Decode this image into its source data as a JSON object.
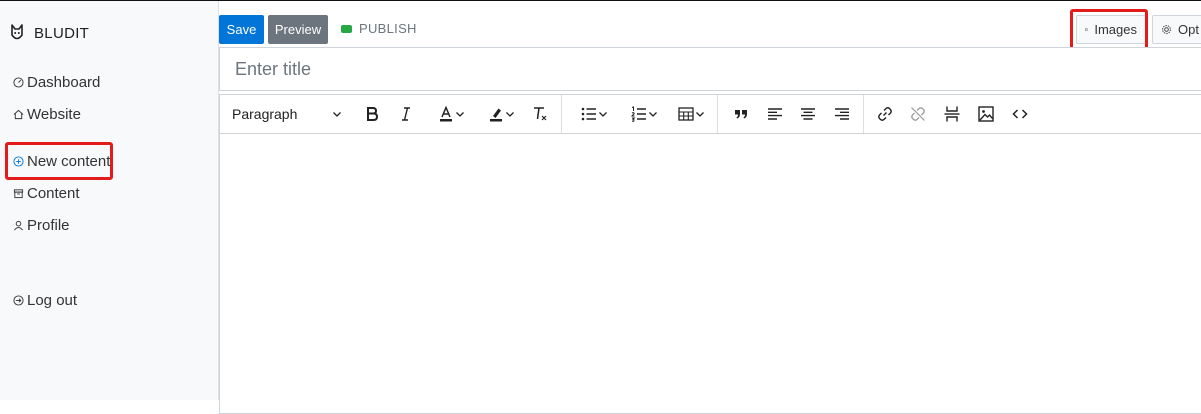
{
  "brand": {
    "name": "BLUDIT",
    "logo_icon": "bludit-logo-icon"
  },
  "sidebar": {
    "items": [
      {
        "label": "Dashboard",
        "icon": "speedometer-icon"
      },
      {
        "label": "Website",
        "icon": "home-icon"
      },
      {
        "label": "New content",
        "icon": "plus-circle-icon",
        "highlighted": true
      },
      {
        "label": "Content",
        "icon": "archive-icon"
      },
      {
        "label": "Profile",
        "icon": "user-icon"
      },
      {
        "label": "Log out",
        "icon": "logout-icon"
      }
    ]
  },
  "toolbar": {
    "save_label": "Save",
    "preview_label": "Preview",
    "status_label": "PUBLISH",
    "images_label": "Images",
    "options_label": "Opt"
  },
  "title": {
    "placeholder": "Enter title",
    "value": ""
  },
  "editor": {
    "format_select": "Paragraph",
    "tools": [
      "bold-icon",
      "italic-icon",
      "text-color-icon",
      "highlight-icon",
      "clear-format-icon",
      "bullet-list-icon",
      "numbered-list-icon",
      "table-icon",
      "blockquote-icon",
      "align-left-icon",
      "align-center-icon",
      "align-right-icon",
      "link-icon",
      "unlink-icon",
      "page-break-icon",
      "image-icon",
      "code-icon"
    ]
  },
  "colors": {
    "primary": "#0275d8",
    "secondary": "#6c757d",
    "status": "#28a745",
    "highlight": "#e31b1b"
  }
}
